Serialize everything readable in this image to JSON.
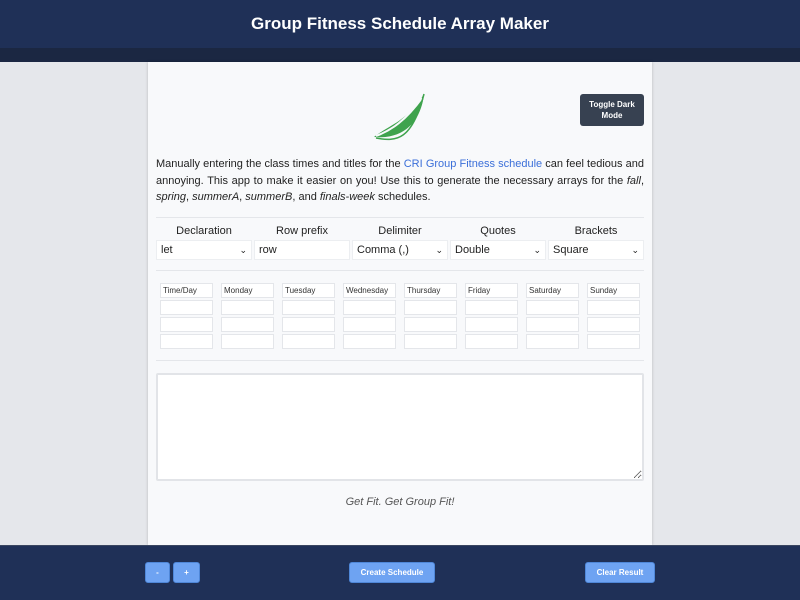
{
  "header": {
    "title": "Group Fitness Schedule Array Maker"
  },
  "toggle_label": "Toggle Dark Mode",
  "logo": "leaf-logo",
  "intro": {
    "p1": "Manually entering the class times and titles for the ",
    "link": "CRI Group Fitness schedule",
    "p2": " can feel tedious and annoying. This app to make it easier on you! Use this to generate the necessary arrays for the ",
    "fall": "fall",
    "c1": ", ",
    "spring": "spring",
    "c2": ", ",
    "summerA": "summerA",
    "c3": ", ",
    "summerB": "summerB",
    "c4": ", and ",
    "finals": "finals-week",
    "p3": " schedules."
  },
  "options": [
    {
      "label": "Declaration",
      "value": "let",
      "type": "select"
    },
    {
      "label": "Row prefix",
      "value": "row",
      "type": "input"
    },
    {
      "label": "Delimiter",
      "value": "Comma (,)",
      "type": "select"
    },
    {
      "label": "Quotes",
      "value": "Double",
      "type": "select"
    },
    {
      "label": "Brackets",
      "value": "Square",
      "type": "select"
    }
  ],
  "grid_headers": [
    "Time/Day",
    "Monday",
    "Tuesday",
    "Wednesday",
    "Thursday",
    "Friday",
    "Saturday",
    "Sunday"
  ],
  "grid_rows": 3,
  "result_value": "",
  "tagline": "Get Fit. Get Group Fit!",
  "footer": {
    "minus": "-",
    "plus": "+",
    "create": "Create Schedule",
    "clear": "Clear Result"
  },
  "colors": {
    "navy": "#1f3057",
    "button": "#6ea3f2",
    "leaf": "#3fa34d",
    "link": "#3b6fd9"
  }
}
